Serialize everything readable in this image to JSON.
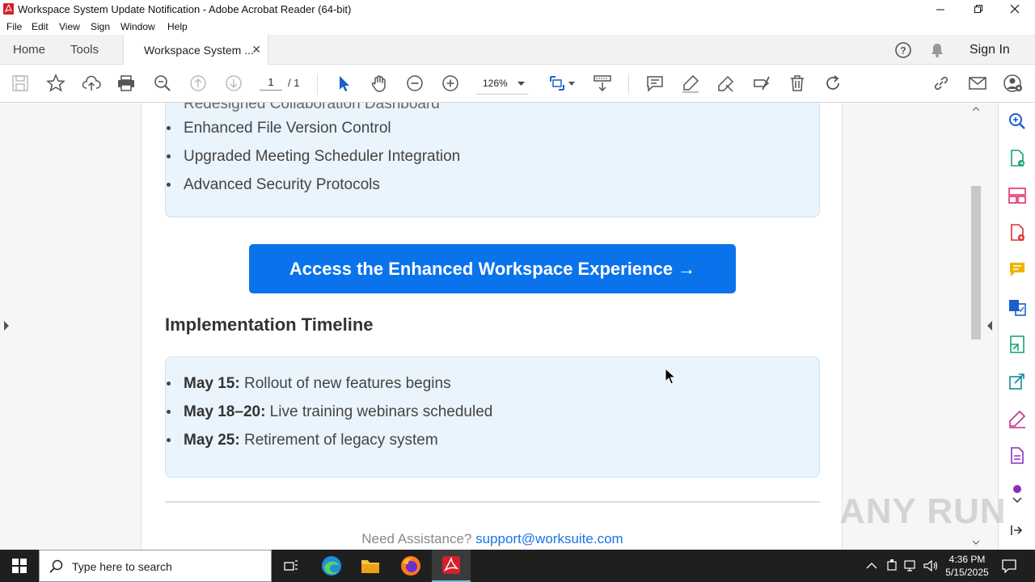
{
  "window": {
    "title": "Workspace System Update Notification - Adobe Acrobat Reader (64-bit)"
  },
  "menu": [
    "File",
    "Edit",
    "View",
    "Sign",
    "Window",
    "Help"
  ],
  "tabs": {
    "home": "Home",
    "tools": "Tools",
    "document": "Workspace System ...",
    "sign_in": "Sign In"
  },
  "toolbar": {
    "page_current": "1",
    "page_total": "/ 1",
    "zoom": "126%"
  },
  "document": {
    "features_partial": "Redesigned Collaboration Dashboard",
    "features": [
      "Enhanced File Version Control",
      "Upgraded Meeting Scheduler Integration",
      "Advanced Security Protocols"
    ],
    "cta": "Access the Enhanced Workspace Experience →",
    "timeline_heading": "Implementation Timeline",
    "timeline": [
      {
        "date": "May 15:",
        "text": " Rollout of new features begins"
      },
      {
        "date": "May 18–20:",
        "text": " Live training webinars scheduled"
      },
      {
        "date": "May 25:",
        "text": " Retirement of legacy system"
      }
    ],
    "footer_text": "Need Assistance? ",
    "footer_link": "support@worksuite.com"
  },
  "taskbar": {
    "search_placeholder": "Type here to search",
    "time": "4:36 PM",
    "date": "5/15/2025"
  },
  "watermark": "ANY RUN",
  "colors": {
    "accent": "#0a73eb",
    "box_bg": "#eaf4fc",
    "acrobat_red": "#d4202a",
    "panel_pink": "#e0306e"
  }
}
